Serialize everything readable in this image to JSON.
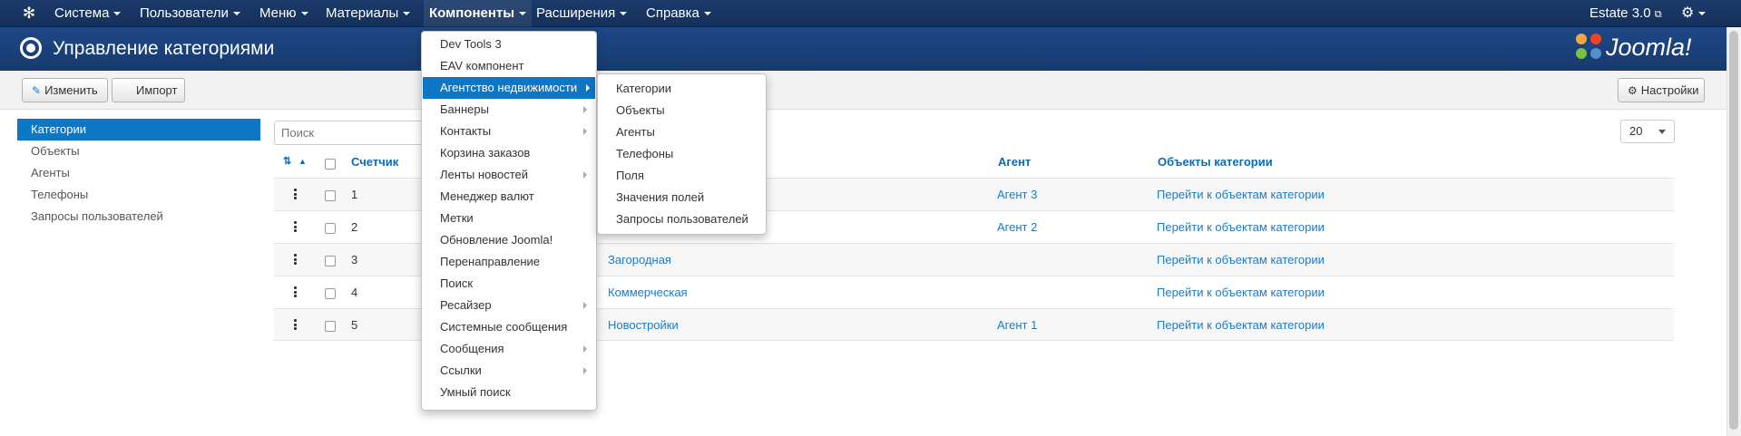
{
  "navbar": {
    "logo": "joomla-logo",
    "items": [
      {
        "label": "Система",
        "dropdown": true
      },
      {
        "label": "Пользователи",
        "dropdown": true
      },
      {
        "label": "Меню",
        "dropdown": true
      },
      {
        "label": "Материалы",
        "dropdown": true
      },
      {
        "label": "Компоненты",
        "dropdown": true,
        "active": true
      },
      {
        "label": "Расширения",
        "dropdown": true
      },
      {
        "label": "Справка",
        "dropdown": true
      }
    ],
    "site_name": "Estate 3.0",
    "external_icon": "⧉",
    "settings_icon": "⚙"
  },
  "header": {
    "title": "Управление категориями",
    "brand": "Joomla!"
  },
  "toolbar": {
    "edit_label": "Изменить",
    "edit_icon": "✎",
    "import_label": "Импорт",
    "options_label": "Настройки",
    "options_icon": "⚙"
  },
  "sidebar": {
    "items": [
      {
        "label": "Категории",
        "active": true
      },
      {
        "label": "Объекты"
      },
      {
        "label": "Агенты"
      },
      {
        "label": "Телефоны"
      },
      {
        "label": "Запросы пользователей"
      }
    ]
  },
  "filters": {
    "search_placeholder": "Поиск",
    "limit": "20"
  },
  "table": {
    "headers": {
      "counter": "Счетчик",
      "agent": "Агент",
      "objects": "Объекты категории"
    },
    "rows": [
      {
        "counter": "1",
        "name": "",
        "agent": "Агент 3",
        "objects": "Перейти к объектам категории"
      },
      {
        "counter": "2",
        "name": "",
        "agent": "Агент 2",
        "objects": "Перейти к объектам категории"
      },
      {
        "counter": "3",
        "name": "Загородная",
        "agent": "",
        "objects": "Перейти к объектам категории"
      },
      {
        "counter": "4",
        "name": "Коммерческая",
        "agent": "",
        "objects": "Перейти к объектам категории"
      },
      {
        "counter": "5",
        "name": "Новостройки",
        "agent": "Агент 1",
        "objects": "Перейти к объектам категории"
      }
    ]
  },
  "components_menu": {
    "items": [
      {
        "label": "Dev Tools 3"
      },
      {
        "label": "EAV компонент"
      },
      {
        "label": "Агентство недвижимости",
        "submenu": true,
        "active": true
      },
      {
        "label": "Баннеры",
        "submenu": true
      },
      {
        "label": "Контакты",
        "submenu": true
      },
      {
        "label": "Корзина заказов"
      },
      {
        "label": "Ленты новостей",
        "submenu": true
      },
      {
        "label": "Менеджер валют"
      },
      {
        "label": "Метки"
      },
      {
        "label": "Обновление Joomla!"
      },
      {
        "label": "Перенаправление"
      },
      {
        "label": "Поиск"
      },
      {
        "label": "Ресайзер",
        "submenu": true
      },
      {
        "label": "Системные сообщения"
      },
      {
        "label": "Сообщения",
        "submenu": true
      },
      {
        "label": "Ссылки",
        "submenu": true
      },
      {
        "label": "Умный поиск"
      }
    ]
  },
  "agency_submenu": {
    "items": [
      {
        "label": "Категории"
      },
      {
        "label": "Объекты"
      },
      {
        "label": "Агенты"
      },
      {
        "label": "Телефоны"
      },
      {
        "label": "Поля"
      },
      {
        "label": "Значения полей"
      },
      {
        "label": "Запросы пользователей"
      }
    ]
  }
}
